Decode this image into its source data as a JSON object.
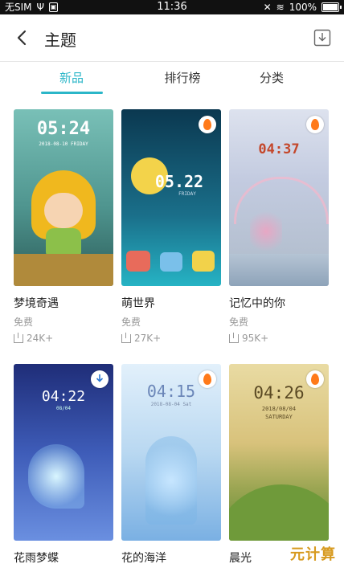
{
  "status_bar": {
    "carrier": "无SIM",
    "time": "11:36",
    "battery_percent": "100%",
    "battery_level": 1.0
  },
  "header": {
    "title": "主题",
    "back_icon": "chevron-left-icon",
    "download_icon": "download-icon"
  },
  "tabs": {
    "items": [
      "新品",
      "排行榜",
      "分类"
    ],
    "active_index": 0
  },
  "themes": [
    {
      "name": "梦境奇遇",
      "price": "免费",
      "downloads": "24K+",
      "clock": "05:24",
      "date": "2018-08-10  FRIDAY",
      "badge": "none",
      "colors": [
        "#5fa7a0",
        "#2e6f6a"
      ]
    },
    {
      "name": "萌世界",
      "price": "免费",
      "downloads": "27K+",
      "clock": "05.22",
      "date": "FRIDAY",
      "badge": "flame",
      "colors": [
        "#0f4b6a",
        "#17a1b8"
      ]
    },
    {
      "name": "记忆中的你",
      "price": "免费",
      "downloads": "95K+",
      "clock": "04:37",
      "date": "",
      "badge": "flame",
      "colors": [
        "#c9d1e6",
        "#a9b7c8"
      ]
    },
    {
      "name": "花雨梦蝶",
      "price": "",
      "downloads": "",
      "clock": "04:22",
      "date": "08/04",
      "badge": "download",
      "colors": [
        "#2f3f8f",
        "#6c89d9"
      ]
    },
    {
      "name": "花的海洋",
      "price": "",
      "downloads": "",
      "clock": "04:15",
      "date": "2018-08-04  Sat",
      "badge": "flame",
      "colors": [
        "#cfe6f5",
        "#7db4e6"
      ]
    },
    {
      "name": "晨光",
      "price": "",
      "downloads": "",
      "clock": "04:26",
      "date": "2018/08/04",
      "weekday": "SATURDAY",
      "badge": "flame",
      "colors": [
        "#d9c27a",
        "#6d8f3a"
      ]
    }
  ],
  "watermark": "元计算"
}
